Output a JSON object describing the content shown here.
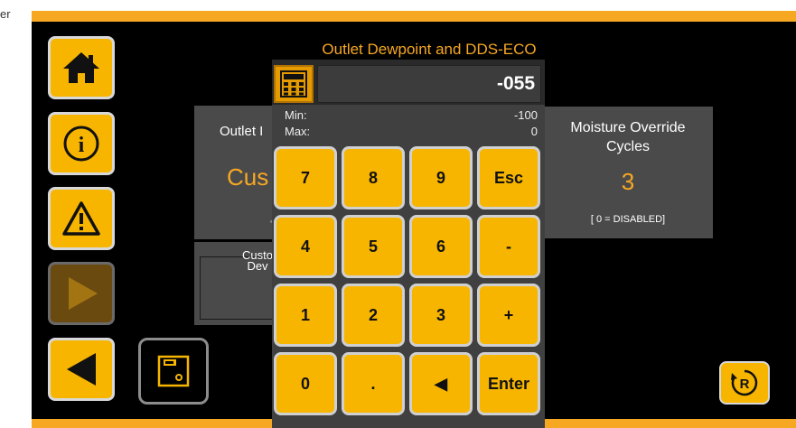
{
  "corner_text": "er",
  "page_title": "Outlet Dewpoint and DDS-ECO",
  "colors": {
    "accent": "#f7a823",
    "button": "#f7b500",
    "panel": "#4a4a4a"
  },
  "nav": {
    "home_icon": "home-icon",
    "info_icon": "info-icon",
    "alarm_icon": "warning-icon",
    "next_icon": "play-icon",
    "back_icon": "back-arrow-icon",
    "save_icon": "save-icon",
    "reset_icon": "reset-r-icon",
    "reset_label": "R"
  },
  "left_panel": {
    "label": "Outlet I",
    "value": "Cus",
    "fragment": "‘"
  },
  "left_panel2": {
    "label_line1": "Custo",
    "label_line2": "Dev"
  },
  "right_panel": {
    "label_line1": "Moisture Override",
    "label_line2": "Cycles",
    "value": "3",
    "note": "[ 0 = DISABLED]"
  },
  "keypad": {
    "display_value": "-055",
    "min_label": "Min:",
    "min_value": "-100",
    "max_label": "Max:",
    "max_value": "0",
    "keys": [
      [
        "7",
        "8",
        "9",
        "Esc"
      ],
      [
        "4",
        "5",
        "6",
        "-"
      ],
      [
        "1",
        "2",
        "3",
        "+"
      ],
      [
        "0",
        ".",
        "◀",
        "Enter"
      ]
    ]
  }
}
